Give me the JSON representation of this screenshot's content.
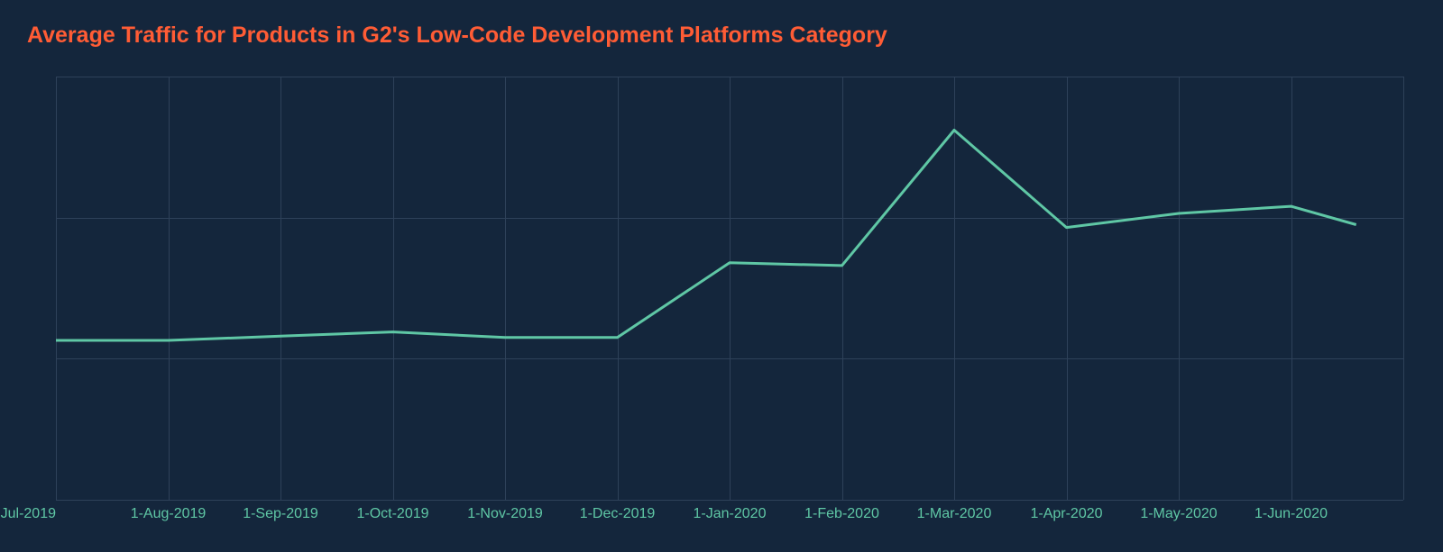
{
  "chart_data": {
    "type": "line",
    "title": "Average Traffic for Products in G2's Low-Code Development Platforms Category",
    "categories": [
      "1-Jul-2019",
      "1-Aug-2019",
      "1-Sep-2019",
      "1-Oct-2019",
      "1-Nov-2019",
      "1-Dec-2019",
      "1-Jan-2020",
      "1-Feb-2020",
      "1-Mar-2020",
      "1-Apr-2020",
      "1-May-2020",
      "1-Jun-2020"
    ],
    "values": [
      1.13,
      1.13,
      1.16,
      1.19,
      1.15,
      1.15,
      1.68,
      1.66,
      2.62,
      1.93,
      2.03,
      2.08
    ],
    "xlabel": "",
    "ylabel": "",
    "ylim": [
      0,
      3
    ],
    "y_gridlines": [
      0,
      1,
      2,
      3
    ],
    "last_point_x_fraction": 0.965,
    "last_point_value": 1.95,
    "line_color": "#5fc7a5",
    "title_color": "#ff5c35"
  }
}
